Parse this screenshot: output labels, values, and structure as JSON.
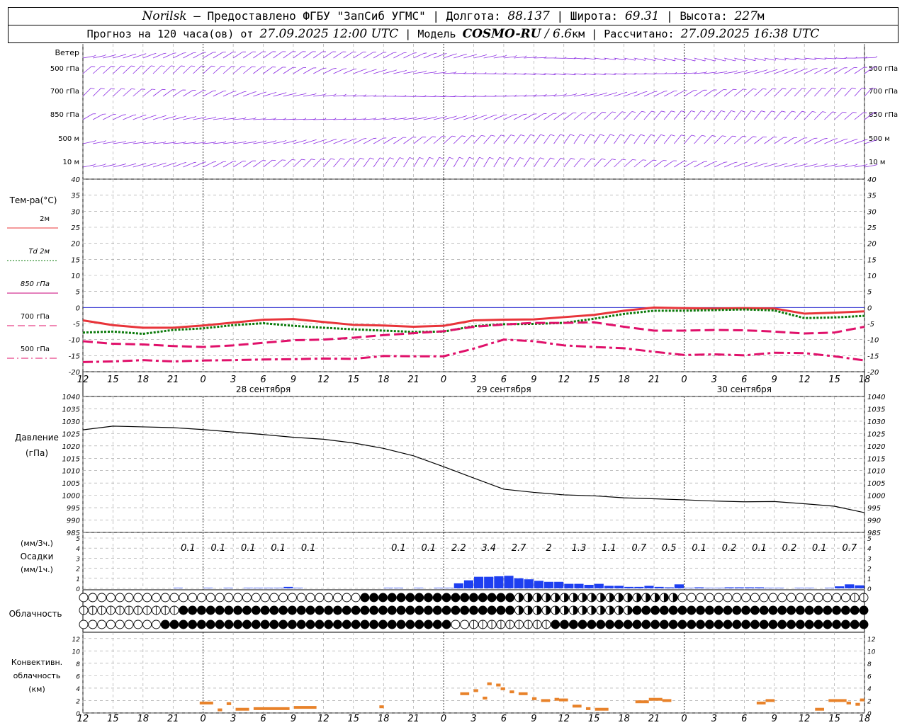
{
  "header": {
    "station": "Norilsk",
    "dash": " – ",
    "provider": "Предоставлено ФГБУ \"ЗапСиб УГМС\"",
    "sep": " | ",
    "lon_label": "Долгота: ",
    "lon": "88.137",
    "lat_label": "Широта: ",
    "lat": "69.31",
    "alt_label": "Высота: ",
    "alt": "227",
    "alt_unit": "м",
    "forecast_label": "Прогноз на 120 часа(ов) от ",
    "forecast_start": "27.09.2025 12:00 UTC",
    "model_label": "| Модель ",
    "model": "COSMO-RU",
    "res_sep": " / ",
    "res": "6.6",
    "res_unit": "км",
    "calc_label": " | Рассчитано: ",
    "calc": "27.09.2025 16:38 UTC"
  },
  "colors": {
    "wind": "#8a2be2",
    "t2m": "#e8343a",
    "td2m": "#0a7a0a",
    "t850": "#c8007a",
    "t700": "#e0106a",
    "t500": "#e0106a",
    "zero": "#2a2ad0",
    "precip": "#1e3ff0",
    "conv": "#e8822a",
    "grid": "#999999"
  },
  "time_axis": {
    "hour_labels": [
      "12",
      "15",
      "18",
      "21",
      "0",
      "3",
      "6",
      "9",
      "12",
      "15",
      "18",
      "21",
      "0",
      "3",
      "6",
      "9",
      "12",
      "15",
      "18",
      "21",
      "0",
      "3",
      "6",
      "9",
      "12",
      "15",
      "18"
    ],
    "day_labels": [
      {
        "text": "28 сентября",
        "hour": 18
      },
      {
        "text": "29 сентября",
        "hour": 42
      },
      {
        "text": "30 сентября",
        "hour": 66
      }
    ],
    "midnights": [
      12,
      36,
      60
    ]
  },
  "wind_panel": {
    "row_labels": [
      "Ветер",
      "500 гПа",
      "700 гПа",
      "850 гПа",
      "500 м",
      "10  м"
    ],
    "right_labels": [
      "500 гПа",
      "700 гПа",
      "850 гПа",
      "500 м",
      "10  м"
    ]
  },
  "temperature_panel": {
    "title": "Тем-ра(°C)",
    "legend": [
      {
        "label": "2м",
        "style": "solid",
        "series": "t2m"
      },
      {
        "label": "Td  2м",
        "style": "dotted",
        "series": "td2m"
      },
      {
        "label": "850 гПа",
        "style": "solid",
        "series": "t850"
      },
      {
        "label": "700 гПа",
        "style": "dashed",
        "series": "t700"
      },
      {
        "label": "500 гПа",
        "style": "dashdot",
        "series": "t500"
      }
    ],
    "ylim": [
      -20,
      40
    ],
    "yticks": [
      "40",
      "35",
      "30",
      "25",
      "20",
      "15",
      "10",
      "5",
      "0",
      "-5",
      "-10",
      "-15",
      "-20"
    ]
  },
  "pressure_panel": {
    "title_line1": "Давление",
    "title_line2": "(гПа)",
    "ylim": [
      985,
      1040
    ],
    "yticks": [
      "1040",
      "1035",
      "1030",
      "1025",
      "1020",
      "1015",
      "1010",
      "1005",
      "1000",
      "995",
      "990",
      "985"
    ]
  },
  "precip_panel": {
    "label_line1": "(мм/3ч.)",
    "label_line2": "Осадки",
    "label_line3": "(мм/1ч.)",
    "ylim": [
      0,
      5
    ],
    "yticks": [
      "5",
      "4",
      "3",
      "2",
      "1",
      "0"
    ],
    "totals_3h": [
      "",
      "",
      "",
      "0.1",
      "0.1",
      "0.1",
      "0.1",
      "0.1",
      "",
      "",
      "0.1",
      "0.1",
      "2.2",
      "3.4",
      "2.7",
      "2",
      "1.3",
      "1.1",
      "0.7",
      "0.5",
      "0.1",
      "0.2",
      "0.1",
      "0.2",
      "0.1",
      "0.7"
    ]
  },
  "cloud_panel": {
    "label": "Облачность",
    "rows": [
      "high",
      "middle",
      "low"
    ]
  },
  "conv_panel": {
    "label_line1": "Конвективн.",
    "label_line2": "облачность",
    "label_line3": "(км)",
    "ylim": [
      0,
      13
    ],
    "yticks": [
      "12",
      "10",
      "8",
      "6",
      "4",
      "2",
      "0"
    ]
  },
  "chart_data": {
    "type": "line",
    "x_hours_from_start": [
      0,
      3,
      6,
      9,
      12,
      15,
      18,
      21,
      24,
      27,
      30,
      33,
      36,
      39,
      42,
      45,
      48,
      51,
      54,
      57,
      60,
      63,
      66,
      69,
      72,
      75,
      78
    ],
    "series": [
      {
        "name": "2м",
        "key": "t2m",
        "values": [
          -4,
          -5.5,
          -6.3,
          -6.3,
          -5.6,
          -4.7,
          -3.8,
          -3.6,
          -4.5,
          -5.4,
          -5.6,
          -6,
          -5.7,
          -4,
          -3.8,
          -3.7,
          -3,
          -2.3,
          -1,
          0,
          -0.2,
          -0.3,
          -0.2,
          -0.3,
          -1.9,
          -1.6,
          -1.2
        ]
      },
      {
        "name": "Td  2м",
        "key": "td2m",
        "values": [
          -7.8,
          -7.5,
          -8.2,
          -7,
          -6.5,
          -5.5,
          -4.9,
          -5.7,
          -6.3,
          -6.8,
          -7.2,
          -7.6,
          -7.5,
          -5.8,
          -5.2,
          -5.1,
          -4.8,
          -3.5,
          -2,
          -1,
          -1,
          -0.8,
          -0.6,
          -0.9,
          -3.3,
          -3.1,
          -2.6
        ]
      },
      {
        "name": "700 гПа",
        "key": "t700",
        "values": [
          -10.5,
          -11.3,
          -11.5,
          -12,
          -12.3,
          -11.8,
          -11,
          -10.2,
          -10,
          -9.4,
          -8.6,
          -8,
          -7.4,
          -6,
          -5.3,
          -4.8,
          -4.8,
          -4.6,
          -6,
          -7.2,
          -7.2,
          -7,
          -7.1,
          -7.5,
          -8.1,
          -7.8,
          -6
        ]
      },
      {
        "name": "500 гПа",
        "key": "t500",
        "values": [
          -17,
          -16.8,
          -16.4,
          -16.8,
          -16.5,
          -16.4,
          -16.2,
          -16.1,
          -15.9,
          -16,
          -15.1,
          -15.2,
          -15.2,
          -12.8,
          -10,
          -10.5,
          -11.8,
          -12.3,
          -12.7,
          -13.8,
          -14.8,
          -14.6,
          -14.9,
          -14.1,
          -14.2,
          -15.2,
          -16.5
        ]
      },
      {
        "name": "Давление",
        "key": "pressure",
        "values": [
          1026.5,
          1028,
          1027.7,
          1027.4,
          1026.6,
          1025.6,
          1024.6,
          1023.5,
          1022.7,
          1021.2,
          1019,
          1016,
          1011.6,
          1007,
          1002.5,
          1001.2,
          1000.2,
          999.8,
          999,
          998.6,
          998.2,
          997.7,
          997.4,
          997.5,
          996.6,
          995.6,
          993
        ]
      }
    ],
    "precip_hourly": [
      0,
      0,
      0,
      0,
      0,
      0,
      0,
      0,
      0,
      0,
      0,
      0,
      0,
      0,
      0,
      0,
      0,
      0,
      0,
      0,
      0,
      0,
      0,
      0,
      0,
      0,
      0,
      0,
      0,
      0,
      0,
      0,
      0,
      0,
      0.1,
      0.1,
      0,
      0,
      0,
      0,
      0,
      0,
      0,
      0,
      0,
      0,
      0,
      0,
      0,
      0,
      0,
      0,
      0,
      0,
      0,
      0,
      0,
      0,
      0,
      0,
      0,
      0,
      0,
      0,
      0,
      0,
      0,
      0.1,
      0.1,
      0,
      0,
      0,
      0,
      0,
      0,
      0,
      0,
      0,
      0,
      0,
      0,
      0,
      0,
      0,
      0.4,
      0.4,
      0,
      0,
      0,
      0,
      0,
      0,
      0,
      0,
      0,
      0,
      0,
      0,
      0,
      0,
      0,
      0,
      0,
      0,
      0,
      0,
      0,
      0,
      0,
      0,
      0,
      0,
      0,
      0,
      0,
      0,
      0,
      0,
      0,
      0,
      0
    ],
    "conv_segments": [
      {
        "h0": 26,
        "h1": 29,
        "km": 1.6
      },
      {
        "h0": 30,
        "h1": 31,
        "km": 0.5
      },
      {
        "h0": 32,
        "h1": 33,
        "km": 1.5
      },
      {
        "h0": 34,
        "h1": 37,
        "km": 0.6
      },
      {
        "h0": 38,
        "h1": 46,
        "km": 0.7
      },
      {
        "h0": 47,
        "h1": 52,
        "km": 0.9
      },
      {
        "h0": 66,
        "h1": 67,
        "km": 1.0
      },
      {
        "h0": 84,
        "h1": 86,
        "km": 3.1
      },
      {
        "h0": 87,
        "h1": 88,
        "km": 3.6
      },
      {
        "h0": 89,
        "h1": 90,
        "km": 2.4
      },
      {
        "h0": 90,
        "h1": 91,
        "km": 4.7
      },
      {
        "h0": 92,
        "h1": 93,
        "km": 4.5
      },
      {
        "h0": 93,
        "h1": 94,
        "km": 3.9
      },
      {
        "h0": 95,
        "h1": 96,
        "km": 3.4
      },
      {
        "h0": 97,
        "h1": 99,
        "km": 3.1
      },
      {
        "h0": 100,
        "h1": 101,
        "km": 2.3
      },
      {
        "h0": 102,
        "h1": 104,
        "km": 2.0
      },
      {
        "h0": 105,
        "h1": 106,
        "km": 2.2
      },
      {
        "h0": 106,
        "h1": 108,
        "km": 2.1
      },
      {
        "h0": 109,
        "h1": 111,
        "km": 1.1
      },
      {
        "h0": 112,
        "h1": 113,
        "km": 0.7
      },
      {
        "h0": 114,
        "h1": 117,
        "km": 0.6
      },
      {
        "h0": 123,
        "h1": 126,
        "km": 1.8
      },
      {
        "h0": 126,
        "h1": 129,
        "km": 2.2
      },
      {
        "h0": 129,
        "h1": 131,
        "km": 2.0
      },
      {
        "h0": 150,
        "h1": 152,
        "km": 1.6
      },
      {
        "h0": 152,
        "h1": 154,
        "km": 2.0
      },
      {
        "h0": 163,
        "h1": 165,
        "km": 0.6
      },
      {
        "h0": 166,
        "h1": 168,
        "km": 2.0
      },
      {
        "h0": 168,
        "h1": 170,
        "km": 2.0
      },
      {
        "h0": 170,
        "h1": 171,
        "km": 1.6
      },
      {
        "h0": 172,
        "h1": 173,
        "km": 1.4
      },
      {
        "h0": 173,
        "h1": 174,
        "km": 2.1
      }
    ],
    "xlabel": "",
    "ylabel": ""
  }
}
